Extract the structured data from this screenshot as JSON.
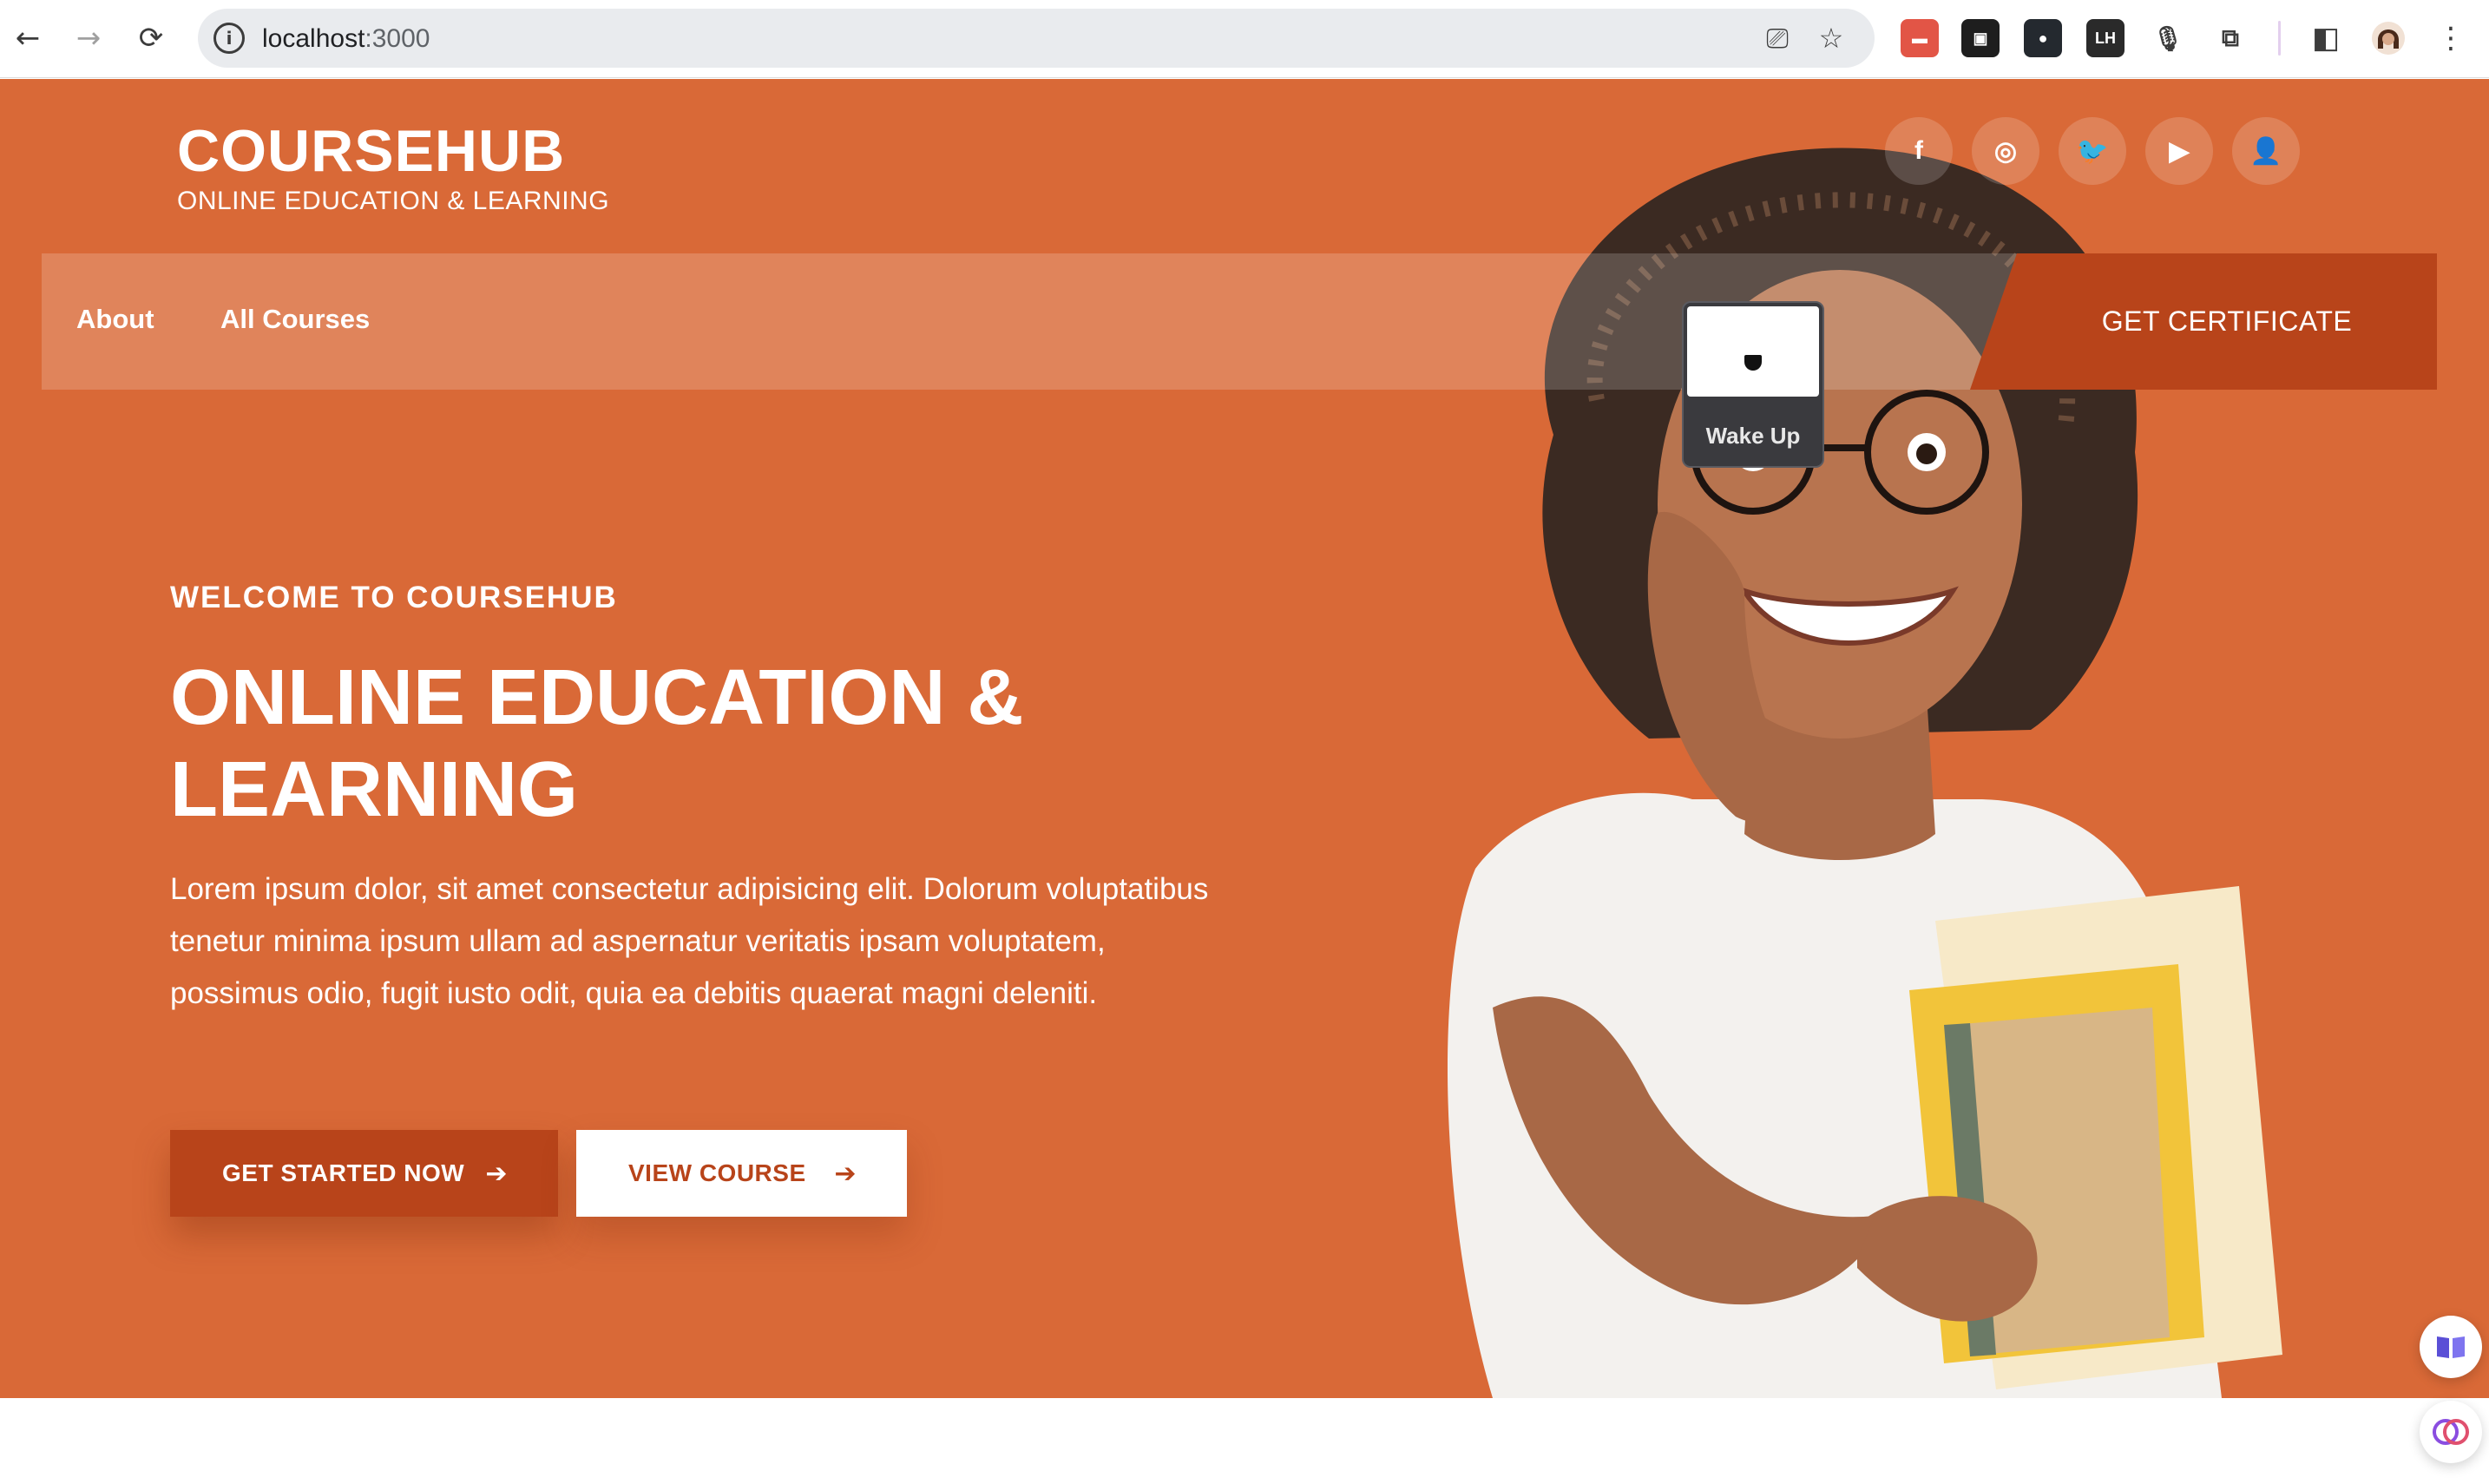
{
  "browser": {
    "back_glyph": "←",
    "forward_glyph": "→",
    "reload_glyph": "⟳",
    "info_glyph": "i",
    "url_host": "localhost",
    "url_port": ":3000",
    "install_glyph": "⎚",
    "star_glyph": "☆",
    "extensions": [
      {
        "name": "ext-red-icon",
        "text": "▬",
        "color": "#e25546"
      },
      {
        "name": "ext-terminal-icon",
        "text": "▣",
        "color": "#1e1e1e"
      },
      {
        "name": "github-icon",
        "text": "●",
        "color": "#24292f"
      },
      {
        "name": "lighthouse-icon",
        "text": "LH",
        "color": "#2a2a2a"
      },
      {
        "name": "microphone-icon",
        "text": "🎙",
        "color": "#ffffff"
      },
      {
        "name": "puzzle-icon",
        "text": "⧉",
        "color": "#ffffff"
      }
    ],
    "sidepanel_glyph": "◧",
    "menu_glyph": "⋮"
  },
  "header": {
    "brand_title": "COURSEHUB",
    "brand_subtitle": "ONLINE EDUCATION & LEARNING",
    "social": [
      {
        "name": "facebook-icon",
        "glyph": "f"
      },
      {
        "name": "instagram-icon",
        "glyph": "◎"
      },
      {
        "name": "twitter-icon",
        "glyph": "🐦"
      },
      {
        "name": "youtube-icon",
        "glyph": "▶"
      },
      {
        "name": "user-icon",
        "glyph": "👤"
      }
    ]
  },
  "nav": {
    "about": "About",
    "all_courses": "All Courses",
    "certificate": "GET CERTIFICATE"
  },
  "popup": {
    "label": "Wake Up"
  },
  "hero": {
    "welcome": "WELCOME TO COURSEHUB",
    "headline": "ONLINE EDUCATION & LEARNING",
    "paragraph": "Lorem ipsum dolor, sit amet consectetur adipisicing elit. Dolorum voluptatibus tenetur minima ipsum ullam ad aspernatur veritatis ipsam voluptatem, possimus odio, fugit iusto odit, quia ea debitis quaerat magni deleniti.",
    "primary_button": "GET STARTED NOW",
    "secondary_button": "VIEW COURSE",
    "arrow_glyph": "➔"
  },
  "colors": {
    "hero_bg": "#d96937",
    "accent_dark": "#b8441a",
    "white": "#ffffff"
  }
}
